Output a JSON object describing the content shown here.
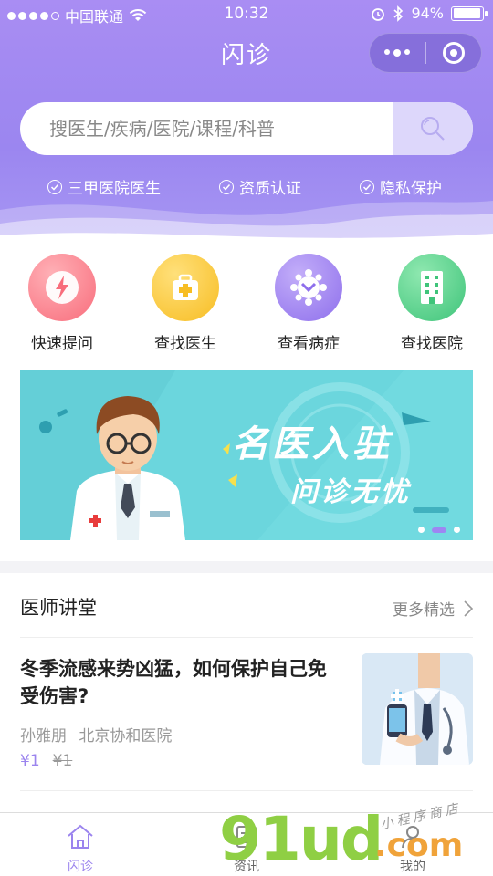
{
  "status_bar": {
    "carrier": "中国联通",
    "time": "10:32",
    "battery_percent": "94%",
    "battery_level": 0.94
  },
  "nav": {
    "title": "闪诊"
  },
  "search": {
    "placeholder": "搜医生/疾病/医院/课程/科普"
  },
  "badges": [
    {
      "label": "三甲医院医生"
    },
    {
      "label": "资质认证"
    },
    {
      "label": "隐私保护"
    }
  ],
  "quick_entries": [
    {
      "label": "快速提问",
      "icon": "lightning-icon",
      "color": "#f87b86"
    },
    {
      "label": "查找医生",
      "icon": "medical-kit-icon",
      "color": "#f8c532"
    },
    {
      "label": "查看病症",
      "icon": "virus-icon",
      "color": "#9b7ef0"
    },
    {
      "label": "查找医院",
      "icon": "hospital-icon",
      "color": "#4fcf86"
    }
  ],
  "banner": {
    "title": "名医入驻",
    "subtitle": "问诊无忧",
    "slide_count": 3,
    "active_slide": 2
  },
  "lecture": {
    "section_title": "医师讲堂",
    "more_label": "更多精选",
    "article": {
      "title": "冬季流感来势凶猛，如何保护自己免受伤害?",
      "author": "孙雅朋",
      "hospital": "北京协和医院",
      "price": "¥1",
      "original_price": "¥1"
    }
  },
  "tabbar": {
    "tabs": [
      {
        "label": "闪诊",
        "icon": "home-icon",
        "active": true
      },
      {
        "label": "资讯",
        "icon": "news-icon",
        "active": false
      },
      {
        "label": "我的",
        "icon": "user-icon",
        "active": false
      }
    ]
  },
  "watermark": {
    "brand": "91ud",
    "domain": ".com",
    "tagline": "小程序商店"
  },
  "colors": {
    "primary": "#9b84ee",
    "header_gradient_top": "#a98df3",
    "banner_bg": "#6bd6dd"
  }
}
